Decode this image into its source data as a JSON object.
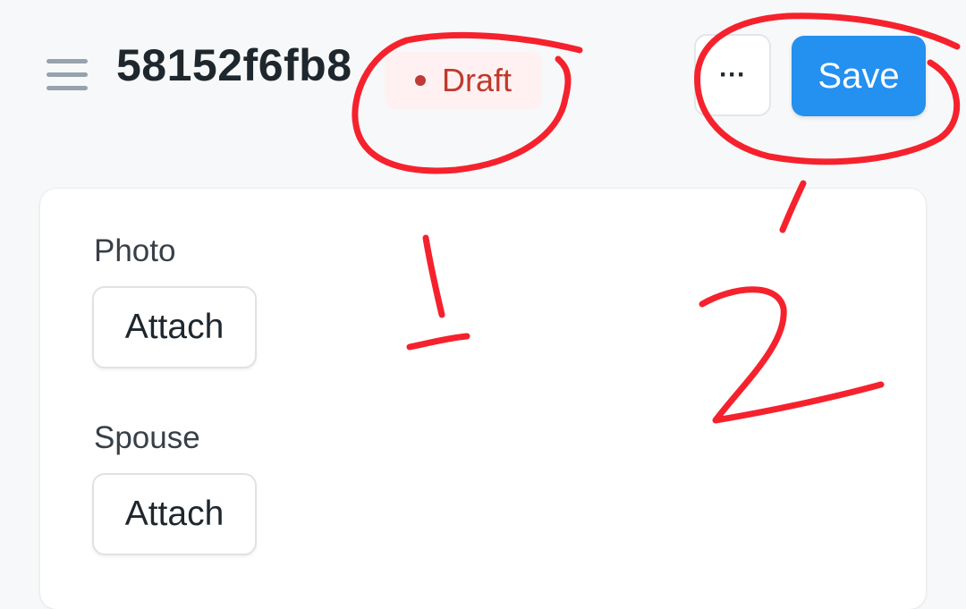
{
  "header": {
    "menu_icon": "hamburger-menu-icon",
    "title": "58152f6fb8",
    "status": {
      "label": "Draft",
      "color": "#c0392b"
    },
    "more_label": "···",
    "save_label": "Save",
    "accent_color": "#2490ef"
  },
  "form": {
    "fields": [
      {
        "label": "Photo",
        "button_label": "Attach"
      },
      {
        "label": "Spouse",
        "button_label": "Attach"
      }
    ]
  },
  "annotations": {
    "color": "#f5222d",
    "marks": [
      "1",
      "2"
    ]
  }
}
